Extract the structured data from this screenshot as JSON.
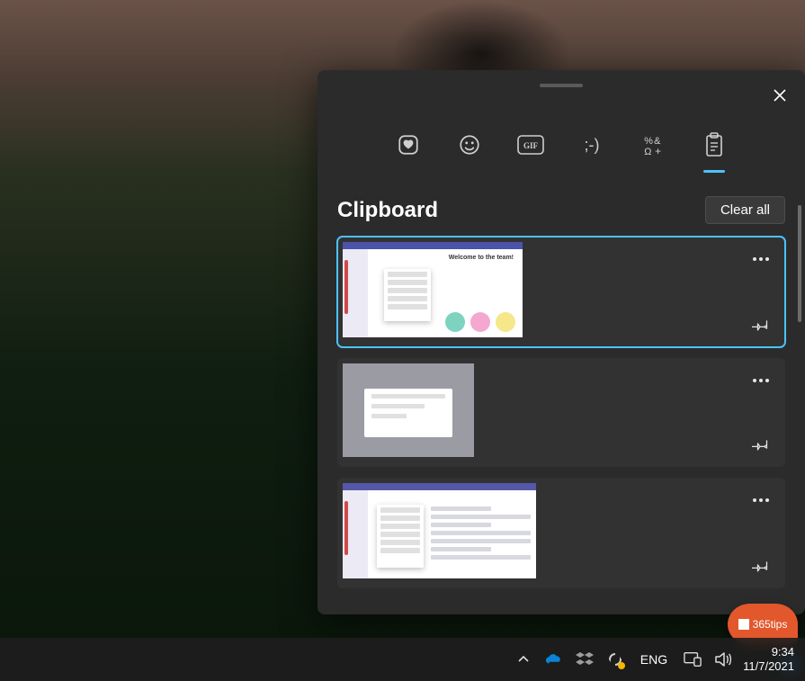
{
  "panel": {
    "title": "Clipboard",
    "clear_label": "Clear all",
    "tabs": [
      {
        "name": "favorites-icon"
      },
      {
        "name": "emoji-icon"
      },
      {
        "name": "gif-icon"
      },
      {
        "name": "kaomoji-icon"
      },
      {
        "name": "symbols-icon"
      },
      {
        "name": "clipboard-icon",
        "active": true
      }
    ],
    "items": [
      {
        "selected": true
      },
      {
        "selected": false
      },
      {
        "selected": false
      }
    ],
    "thumb1_caption": "Welcome to the team!"
  },
  "taskbar": {
    "lang": "ENG",
    "time": "9:34",
    "date": "11/7/2021"
  },
  "badge": {
    "text": "365tips"
  }
}
